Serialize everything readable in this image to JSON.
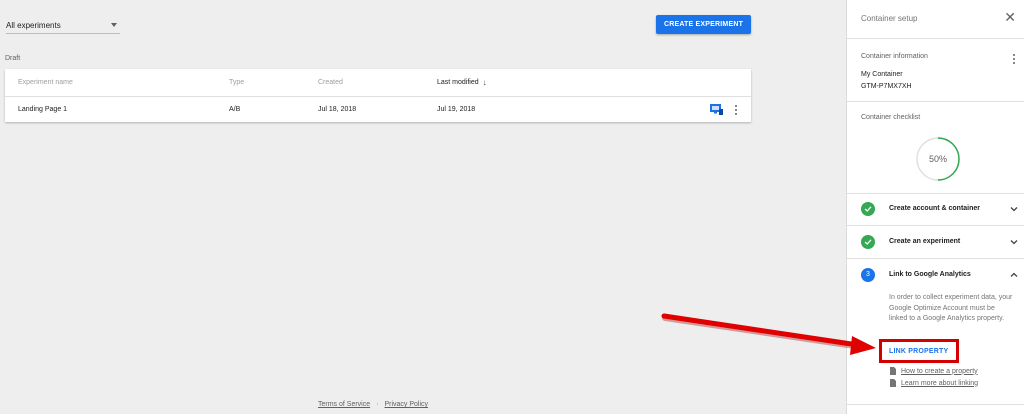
{
  "main": {
    "filter_label": "All experiments",
    "create_button": "CREATE EXPERIMENT",
    "section_label": "Draft",
    "table": {
      "headers": {
        "name": "Experiment name",
        "type": "Type",
        "created": "Created",
        "modified": "Last modified"
      },
      "rows": [
        {
          "name": "Landing Page 1",
          "type": "A/B",
          "created": "Jul 18, 2018",
          "modified": "Jul 19, 2018"
        }
      ]
    },
    "footer": {
      "terms": "Terms of Service",
      "separator": "·",
      "privacy": "Privacy Policy"
    }
  },
  "panel": {
    "title": "Container setup",
    "info_label": "Container information",
    "container_name": "My Container",
    "container_id": "GTM-P7MX7XH",
    "checklist_label": "Container checklist",
    "progress_text": "50%",
    "progress_value": 0.5,
    "steps": [
      {
        "label": "Create account & container",
        "status": "done"
      },
      {
        "label": "Create an experiment",
        "status": "done"
      },
      {
        "label": "Link to Google Analytics",
        "status": "current",
        "number": "3"
      }
    ],
    "step_description": "In order to collect experiment data, your Google Optimize Account must be linked to a Google Analytics property.",
    "link_property": "LINK PROPERTY",
    "help_links": [
      "How to create a property",
      "Learn more about linking"
    ]
  },
  "colors": {
    "accent": "#1a73e8",
    "done": "#34a853",
    "annotation": "#d40000"
  },
  "icons": [
    "chevron-down-icon",
    "close-icon",
    "more-vert-icon",
    "monitor-icon",
    "check-icon",
    "document-icon",
    "sort-arrow-icon"
  ]
}
